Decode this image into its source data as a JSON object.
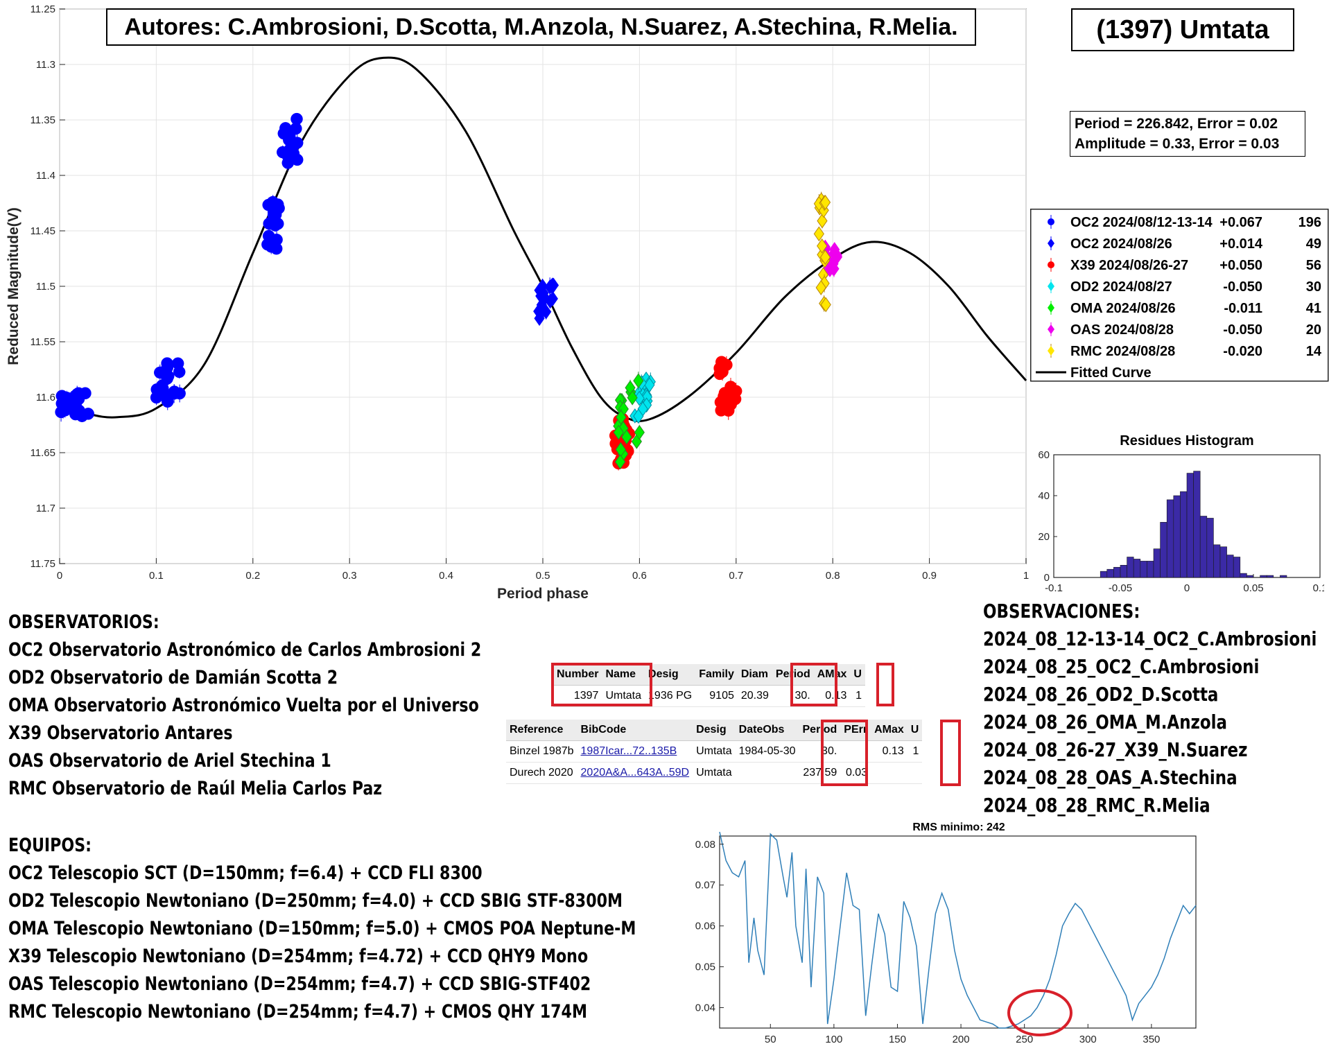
{
  "title_authors": "Autores: C.Ambrosioni, D.Scotta, M.Anzola, N.Suarez, A.Stechina, R.Melia.",
  "object_name": "(1397) Umtata",
  "fit_info": {
    "line1": "Period =  226.842, Error = 0.02",
    "line2": "Amplitude = 0.33, Error = 0.03"
  },
  "colors": {
    "blue": "#0000ff",
    "red": "#ff0000",
    "cyan": "#00e5ee",
    "green": "#00ee00",
    "magenta": "#ee00ee",
    "yellow": "#ffe600",
    "histogram": "#3b2aa6",
    "rms_line": "#2f7fb8",
    "highlight_red": "#d8202a"
  },
  "chart_data": [
    {
      "type": "scatter",
      "xlabel": "Period phase",
      "ylabel": "Reduced Magnitude(V)",
      "xlim": [
        0,
        1
      ],
      "ylim": [
        11.25,
        11.75
      ],
      "y_reversed": true,
      "grid": true,
      "x_ticks": [
        "0",
        "0.1",
        "0.2",
        "0.3",
        "0.4",
        "0.5",
        "0.6",
        "0.7",
        "0.8",
        "0.9",
        "1"
      ],
      "y_ticks": [
        "11.25",
        "11.3",
        "11.35",
        "11.4",
        "11.45",
        "11.5",
        "11.55",
        "11.6",
        "11.65",
        "11.7",
        "11.75"
      ],
      "legend_position": "right",
      "legend": [
        {
          "label": "OC2 2024/08/12-13-14",
          "offset": "+0.067",
          "count": "196",
          "color": "#0000ff",
          "marker": "circle"
        },
        {
          "label": "OC2 2024/08/26",
          "offset": "+0.014",
          "count": "49",
          "color": "#0000ff",
          "marker": "diamond"
        },
        {
          "label": "X39 2024/08/26-27",
          "offset": "+0.050",
          "count": "56",
          "color": "#ff0000",
          "marker": "circle"
        },
        {
          "label": "OD2 2024/08/27",
          "offset": "-0.050",
          "count": "30",
          "color": "#00e5ee",
          "marker": "diamond"
        },
        {
          "label": "OMA 2024/08/26",
          "offset": "-0.011",
          "count": "41",
          "color": "#00ee00",
          "marker": "diamond"
        },
        {
          "label": "OAS 2024/08/28",
          "offset": "-0.050",
          "count": "20",
          "color": "#ee00ee",
          "marker": "diamond"
        },
        {
          "label": "RMC 2024/08/28",
          "offset": "-0.020",
          "count": "14",
          "color": "#ffe600",
          "marker": "diamond"
        },
        {
          "label": "Fitted Curve",
          "offset": "",
          "count": "",
          "color": "#000000",
          "marker": "line"
        }
      ],
      "fitted_curve": {
        "x": [
          0,
          0.03,
          0.06,
          0.1,
          0.15,
          0.2,
          0.25,
          0.3,
          0.335,
          0.37,
          0.42,
          0.47,
          0.5,
          0.53,
          0.56,
          0.585,
          0.61,
          0.65,
          0.7,
          0.75,
          0.8,
          0.84,
          0.88,
          0.92,
          0.96,
          1.0
        ],
        "y": [
          11.605,
          11.615,
          11.618,
          11.61,
          11.57,
          11.47,
          11.37,
          11.31,
          11.294,
          11.305,
          11.36,
          11.45,
          11.5,
          11.555,
          11.6,
          11.618,
          11.62,
          11.6,
          11.56,
          11.51,
          11.475,
          11.46,
          11.47,
          11.5,
          11.545,
          11.585
        ]
      },
      "series": [
        {
          "name": "OC2 2024/08/12-13-14",
          "marker": "circle",
          "color": "#0000ff",
          "clusters": [
            {
              "x": [
                0.0,
                0.03
              ],
              "y": [
                11.59,
                11.625
              ]
            },
            {
              "x": [
                0.1,
                0.125
              ],
              "y": [
                11.56,
                11.615
              ]
            },
            {
              "x": [
                0.215,
                0.228
              ],
              "y": [
                11.41,
                11.48
              ]
            },
            {
              "x": [
                0.23,
                0.246
              ],
              "y": [
                11.34,
                11.4
              ]
            }
          ]
        },
        {
          "name": "OC2 2024/08/26",
          "marker": "diamond",
          "color": "#0000ff",
          "clusters": [
            {
              "x": [
                0.495,
                0.512
              ],
              "y": [
                11.49,
                11.54
              ]
            }
          ]
        },
        {
          "name": "X39 2024/08/26-27",
          "marker": "circle",
          "color": "#ff0000",
          "clusters": [
            {
              "x": [
                0.573,
                0.59
              ],
              "y": [
                11.61,
                11.67
              ]
            },
            {
              "x": [
                0.683,
                0.7
              ],
              "y": [
                11.555,
                11.625
              ]
            }
          ]
        },
        {
          "name": "OD2 2024/08/27",
          "marker": "diamond",
          "color": "#00e5ee",
          "clusters": [
            {
              "x": [
                0.595,
                0.612
              ],
              "y": [
                11.575,
                11.625
              ]
            }
          ]
        },
        {
          "name": "OMA 2024/08/26",
          "marker": "diamond",
          "color": "#00ee00",
          "clusters": [
            {
              "x": [
                0.578,
                0.6
              ],
              "y": [
                11.565,
                11.675
              ]
            }
          ]
        },
        {
          "name": "OAS 2024/08/28",
          "marker": "diamond",
          "color": "#ee00ee",
          "clusters": [
            {
              "x": [
                0.79,
                0.805
              ],
              "y": [
                11.46,
                11.49
              ]
            }
          ]
        },
        {
          "name": "RMC 2024/08/28",
          "marker": "diamond",
          "color": "#ffe600",
          "clusters": [
            {
              "x": [
                0.785,
                0.793
              ],
              "y": [
                11.4,
                11.54
              ]
            }
          ]
        }
      ]
    },
    {
      "type": "bar",
      "title": "Residues Histogram",
      "xlim": [
        -0.1,
        0.1
      ],
      "ylim": [
        0,
        60
      ],
      "x_ticks": [
        "-0.1",
        "-0.05",
        "0",
        "0.05",
        "0.1"
      ],
      "y_ticks": [
        "0",
        "20",
        "40",
        "60"
      ],
      "bin_width": 0.005,
      "bin_centers": [
        -0.0625,
        -0.0575,
        -0.0525,
        -0.0475,
        -0.0425,
        -0.0375,
        -0.0325,
        -0.0275,
        -0.0225,
        -0.0175,
        -0.0125,
        -0.0075,
        -0.0025,
        0.0025,
        0.0075,
        0.0125,
        0.0175,
        0.0225,
        0.0275,
        0.0325,
        0.0375,
        0.0425,
        0.0475,
        0.0525,
        0.0575,
        0.0625,
        0.0675,
        0.0725
      ],
      "values": [
        3,
        4,
        5,
        6,
        10,
        9,
        8,
        8,
        14,
        27,
        38,
        40,
        42,
        51,
        52,
        30,
        29,
        16,
        15,
        11,
        10,
        2,
        1,
        0,
        1,
        1,
        0,
        1
      ]
    },
    {
      "type": "line",
      "title": "RMS minimo: 242",
      "xlim": [
        10,
        385
      ],
      "ylim": [
        0.035,
        0.082
      ],
      "x_ticks": [
        "50",
        "100",
        "150",
        "200",
        "250",
        "300",
        "350"
      ],
      "y_ticks": [
        "0.04",
        "0.05",
        "0.06",
        "0.07",
        "0.08"
      ],
      "x": [
        10,
        15,
        20,
        25,
        30,
        33,
        37,
        40,
        45,
        50,
        55,
        60,
        63,
        67,
        70,
        75,
        78,
        82,
        87,
        92,
        95,
        100,
        105,
        110,
        115,
        120,
        125,
        130,
        135,
        140,
        145,
        150,
        155,
        160,
        165,
        170,
        175,
        180,
        185,
        190,
        195,
        200,
        205,
        210,
        215,
        220,
        225,
        230,
        235,
        240,
        245,
        250,
        255,
        260,
        265,
        270,
        275,
        280,
        285,
        290,
        295,
        300,
        305,
        310,
        315,
        320,
        325,
        330,
        335,
        340,
        345,
        350,
        355,
        360,
        365,
        370,
        375,
        380,
        385
      ],
      "y": [
        0.083,
        0.076,
        0.073,
        0.072,
        0.076,
        0.051,
        0.062,
        0.054,
        0.048,
        0.0825,
        0.081,
        0.072,
        0.067,
        0.078,
        0.06,
        0.051,
        0.074,
        0.045,
        0.072,
        0.068,
        0.036,
        0.047,
        0.06,
        0.073,
        0.065,
        0.064,
        0.038,
        0.051,
        0.063,
        0.058,
        0.045,
        0.044,
        0.066,
        0.062,
        0.055,
        0.036,
        0.05,
        0.063,
        0.068,
        0.064,
        0.054,
        0.047,
        0.043,
        0.04,
        0.037,
        0.0365,
        0.036,
        0.035,
        0.035,
        0.0355,
        0.036,
        0.037,
        0.038,
        0.04,
        0.043,
        0.047,
        0.053,
        0.06,
        0.063,
        0.0655,
        0.064,
        0.061,
        0.058,
        0.055,
        0.052,
        0.049,
        0.046,
        0.043,
        0.037,
        0.041,
        0.043,
        0.045,
        0.048,
        0.052,
        0.057,
        0.061,
        0.065,
        0.063,
        0.065
      ]
    }
  ],
  "observatorios": {
    "heading": "OBSERVATORIOS:",
    "items": [
      "OC2 Observatorio Astronómico de Carlos Ambrosioni 2",
      "OD2 Observatorio de Damián Scotta 2",
      "OMA Observatorio Astronómico Vuelta por el Universo",
      "X39 Observatorio Antares",
      "OAS Observatorio de Ariel Stechina 1",
      "RMC Observatorio de Raúl Melia Carlos Paz"
    ]
  },
  "equipos": {
    "heading": "EQUIPOS:",
    "items": [
      "OC2 Telescopio SCT (D=150mm; f=6.4) + CCD FLI 8300",
      "OD2 Telescopio Newtoniano (D=250mm; f=4.0) + CCD SBIG STF-8300M",
      "OMA Telescopio Newtoniano (D=150mm; f=5.0) + CMOS POA Neptune-M",
      "X39 Telescopio Newtoniano (D=254mm; f=4.72) + CCD QHY9 Mono",
      "OAS Telescopio Newtoniano (D=254mm; f=4.7) + CCD SBIG-STF402",
      "RMC Telescopio Newtoniano (D=254mm; f=4.7) + CMOS QHY 174M"
    ]
  },
  "observaciones": {
    "heading": "OBSERVACIONES:",
    "items": [
      "2024_08_12-13-14_OC2_C.Ambrosioni",
      "2024_08_25_OC2_C.Ambrosioni",
      "2024_08_26_OD2_D.Scotta",
      "2024_08_26_OMA_M.Anzola",
      "2024_08_26-27_X39_N.Suarez",
      "2024_08_28_OAS_A.Stechina",
      "2024_08_28_RMC_R.Melia"
    ]
  },
  "lcdb_table1": {
    "headers": [
      "Number",
      "Name",
      "Desig",
      "Family",
      "Diam",
      "Period",
      "AMax",
      "U"
    ],
    "row": [
      "1397",
      "Umtata",
      "1936 PG",
      "9105",
      "20.39",
      "30.",
      "0.13",
      "1"
    ]
  },
  "lcdb_table2": {
    "headers": [
      "Reference",
      "BibCode",
      "Desig",
      "DateObs",
      "Period",
      "PErr",
      "AMax",
      "U"
    ],
    "rows": [
      [
        "Binzel 1987b",
        "1987Icar...72..135B",
        "Umtata",
        "1984-05-30",
        "30.",
        "",
        "0.13",
        "1"
      ],
      [
        "Durech 2020",
        "2020A&A...643A..59D",
        "Umtata",
        "",
        "237.59",
        "0.03",
        "",
        ""
      ]
    ]
  }
}
